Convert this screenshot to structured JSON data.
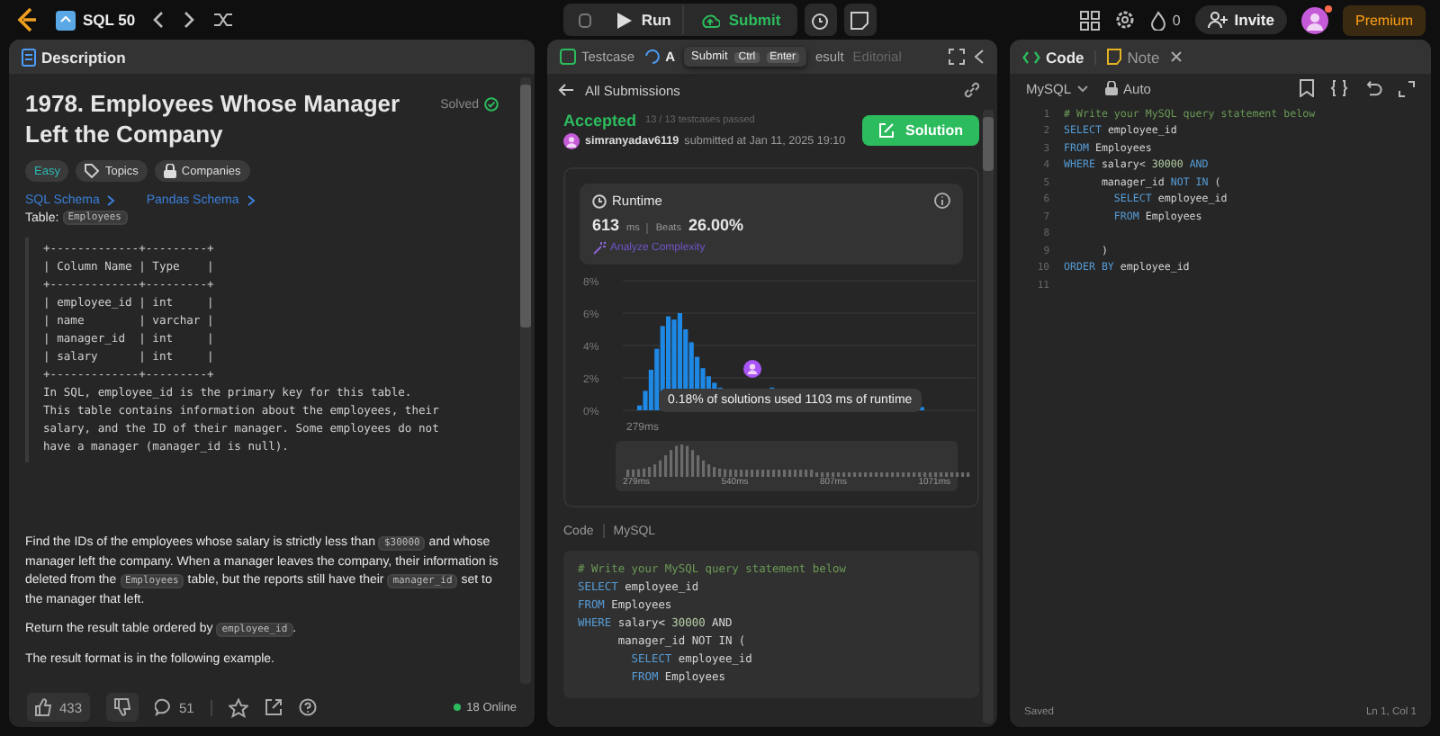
{
  "topbar": {
    "list_title": "SQL 50",
    "run": "Run",
    "submit": "Submit",
    "streak": "0",
    "invite": "Invite",
    "premium": "Premium",
    "avatar_notification": true
  },
  "description": {
    "tab": "Description",
    "title": "1978. Employees Whose Manager Left the Company",
    "status": "Solved",
    "tags": [
      {
        "label": "Easy",
        "kind": "difficulty"
      },
      {
        "label": "Topics",
        "kind": "topics"
      },
      {
        "label": "Companies",
        "kind": "companies"
      }
    ],
    "schema_links": [
      "SQL Schema",
      "Pandas Schema"
    ],
    "table_label": "Table:",
    "table_name": "Employees",
    "schema_block": "+-------------+---------+\n| Column Name | Type    |\n+-------------+---------+\n| employee_id | int     |\n| name        | varchar |\n| manager_id  | int     |\n| salary      | int     |\n+-------------+---------+\nIn SQL, employee_id is the primary key for this table.\nThis table contains information about the employees, their\nsalary, and the ID of their manager. Some employees do not\nhave a manager (manager_id is null).",
    "paragraphs": [
      [
        {
          "kind": "text",
          "t": "Find the IDs of the employees whose salary is strictly less than "
        },
        {
          "kind": "code",
          "t": "$30000"
        },
        {
          "kind": "text",
          "t": " and whose manager left the company. When a manager leaves the company, their information is deleted from the "
        },
        {
          "kind": "code",
          "t": "Employees"
        },
        {
          "kind": "text",
          "t": " table, but the reports still have their "
        },
        {
          "kind": "code",
          "t": "manager_id"
        },
        {
          "kind": "text",
          "t": " set to the manager that left."
        }
      ],
      [
        {
          "kind": "text",
          "t": "Return the result table ordered by "
        },
        {
          "kind": "code",
          "t": "employee_id"
        },
        {
          "kind": "text",
          "t": "."
        }
      ],
      [
        {
          "kind": "text",
          "t": "The result format is in the following example."
        }
      ]
    ],
    "likes": "433",
    "comments": "51",
    "online": "18 Online"
  },
  "result": {
    "tabs": [
      {
        "label": "Testcase",
        "selected": false,
        "disabled": false
      },
      {
        "label": "A",
        "selected": true,
        "disabled": false
      },
      {
        "label": "esult",
        "selected": false,
        "disabled": false
      },
      {
        "label": "Editorial",
        "selected": false,
        "disabled": true
      }
    ],
    "tooltip": {
      "label": "Submit",
      "keys": [
        "Ctrl",
        "Enter"
      ]
    },
    "back": "All Submissions",
    "verdict": "Accepted",
    "passed": "13 / 13 testcases passed",
    "user": "simranyadav6119",
    "submitted": "submitted at Jan 11, 2025 19:10",
    "solution": "Solution",
    "runtime": {
      "title": "Runtime",
      "value": "613",
      "unit": "ms",
      "beats_label": "Beats",
      "beats": "26.00%",
      "analyze": "Analyze Complexity"
    },
    "histogram": {
      "y_ticks": [
        "8%",
        "6%",
        "4%",
        "2%",
        "0%"
      ],
      "x_label": "279ms",
      "tooltip": "0.18% of solutions used 1103 ms of runtime"
    },
    "overview_labels": [
      "279ms",
      "540ms",
      "807ms",
      "1071ms"
    ],
    "code_label": "Code",
    "code_lang": "MySQL",
    "code": [
      [
        {
          "kind": "comment",
          "t": "# Write your MySQL query statement below"
        }
      ],
      [
        {
          "kind": "kw",
          "t": "SELECT"
        },
        {
          "kind": "plain",
          "t": " employee_id"
        }
      ],
      [
        {
          "kind": "kw",
          "t": "FROM"
        },
        {
          "kind": "plain",
          "t": " Employees"
        }
      ],
      [
        {
          "kind": "kw",
          "t": "WHERE"
        },
        {
          "kind": "plain",
          "t": " salary< "
        },
        {
          "kind": "num",
          "t": "30000"
        },
        {
          "kind": "plain",
          "t": " AND"
        }
      ],
      [
        {
          "kind": "plain",
          "t": "      manager_id NOT IN ("
        }
      ],
      [
        {
          "kind": "kw",
          "t": "        SELECT"
        },
        {
          "kind": "plain",
          "t": " employee_id"
        }
      ],
      [
        {
          "kind": "kw",
          "t": "        FROM"
        },
        {
          "kind": "plain",
          "t": " Employees"
        }
      ]
    ]
  },
  "editor": {
    "tabs": [
      {
        "label": "Code",
        "selected": true
      },
      {
        "label": "Note",
        "selected": false
      }
    ],
    "language": "MySQL",
    "mode": "Auto",
    "lines": [
      {
        "n": "1",
        "tokens": [
          {
            "kind": "comment",
            "t": "# Write your MySQL query statement below"
          }
        ]
      },
      {
        "n": "2",
        "tokens": [
          {
            "kind": "kw",
            "t": "SELECT"
          },
          {
            "kind": "plain",
            "t": " employee_id"
          }
        ]
      },
      {
        "n": "3",
        "tokens": [
          {
            "kind": "kw",
            "t": "FROM"
          },
          {
            "kind": "plain",
            "t": " Employees"
          }
        ]
      },
      {
        "n": "4",
        "tokens": [
          {
            "kind": "kw",
            "t": "WHERE"
          },
          {
            "kind": "plain",
            "t": " salary< "
          },
          {
            "kind": "num",
            "t": "30000"
          },
          {
            "kind": "kw",
            "t": " AND"
          }
        ]
      },
      {
        "n": "5",
        "tokens": [
          {
            "kind": "plain",
            "t": "      manager_id "
          },
          {
            "kind": "kw",
            "t": "NOT IN"
          },
          {
            "kind": "plain",
            "t": " ("
          }
        ]
      },
      {
        "n": "6",
        "tokens": [
          {
            "kind": "kw",
            "t": "        SELECT"
          },
          {
            "kind": "plain",
            "t": " employee_id"
          }
        ]
      },
      {
        "n": "7",
        "tokens": [
          {
            "kind": "kw",
            "t": "        FROM"
          },
          {
            "kind": "plain",
            "t": " Employees"
          }
        ]
      },
      {
        "n": "8"
      },
      {
        "n": "9",
        "tokens": [
          {
            "kind": "plain",
            "t": "      )"
          }
        ]
      },
      {
        "n": "10",
        "tokens": [
          {
            "kind": "kw",
            "t": "ORDER BY"
          },
          {
            "kind": "plain",
            "t": " employee_id"
          }
        ]
      },
      {
        "n": "11"
      }
    ],
    "saved": "Saved",
    "cursor": "Ln 1, Col 1"
  }
}
